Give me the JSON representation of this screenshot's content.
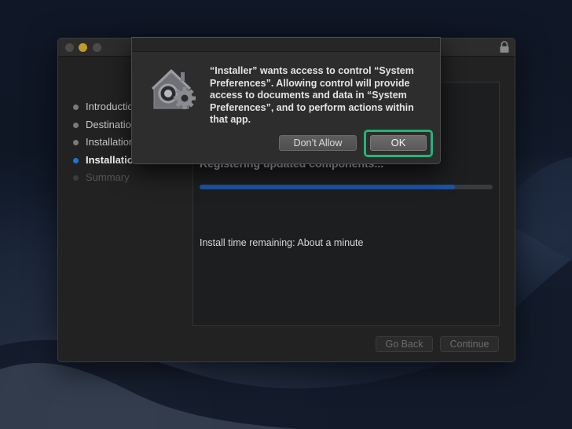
{
  "installer": {
    "steps": [
      {
        "label": "Introduction",
        "state": "done"
      },
      {
        "label": "Destination Select",
        "state": "done"
      },
      {
        "label": "Installation Type",
        "state": "done"
      },
      {
        "label": "Installation",
        "state": "active"
      },
      {
        "label": "Summary",
        "state": "pending"
      }
    ],
    "status_heading": "Registering updated components...",
    "progress_fraction": 0.87,
    "time_remaining": "Install time remaining: About a minute",
    "back_button": "Go Back",
    "continue_button": "Continue"
  },
  "alert": {
    "icon": "gear-lock-icon",
    "message": "“Installer” wants access to control “System Preferences”. Allowing control will provide access to documents and data in “System Preferences”, and to perform actions within that app.",
    "dont_allow_button": "Don’t Allow",
    "ok_button": "OK"
  },
  "colors": {
    "highlight": "#26b27a",
    "progress": "#1d54a8",
    "active_step_dot": "#1f74d6"
  }
}
